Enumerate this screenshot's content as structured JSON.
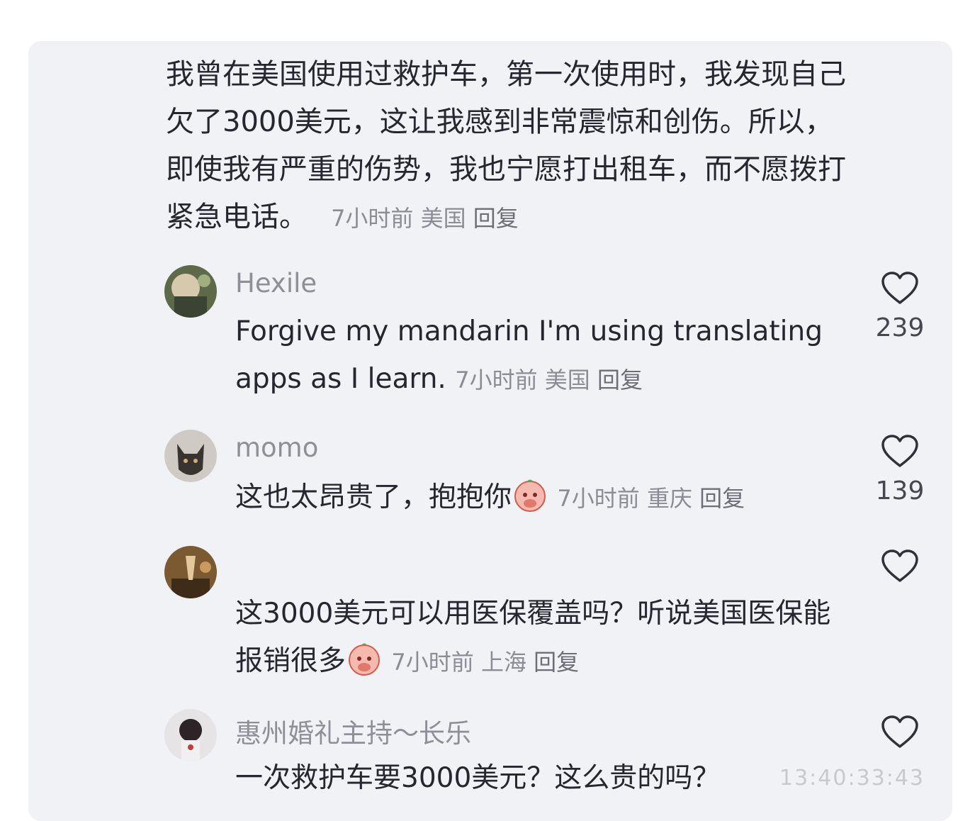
{
  "top_comment": {
    "text": "我曾在美国使用过救护车，第一次使用时，我发现自己欠了3000美元，这让我感到非常震惊和创伤。所以，即使我有严重的伤势，我也宁愿打出租车，而不愿拨打紧急电话。",
    "time": "7小时前",
    "location": "美国",
    "reply": "回复"
  },
  "comments": [
    {
      "username": "Hexile",
      "text": "Forgive my mandarin I'm using translating apps as I learn.",
      "time": "7小时前",
      "location": "美国",
      "reply": "回复",
      "likes": "239"
    },
    {
      "username": "momo",
      "text": "这也太昂贵了，抱抱你",
      "emoji": "hug-emoji",
      "time": "7小时前",
      "location": "重庆",
      "reply": "回复",
      "likes": "139"
    },
    {
      "username": "",
      "text": "这3000美元可以用医保覆盖吗？听说美国医保能报销很多",
      "emoji": "hug-emoji",
      "time": "7小时前",
      "location": "上海",
      "reply": "回复",
      "likes": ""
    },
    {
      "username": "惠州婚礼主持～长乐",
      "text": "一次救护车要3000美元？这么贵的吗？",
      "likes": ""
    }
  ],
  "icons": {
    "like": "heart-outline-icon"
  },
  "colors": {
    "card_bg": "#f1f2f6",
    "text": "#252630",
    "meta": "#8b8c96"
  },
  "watermark": "13:40:33:43"
}
